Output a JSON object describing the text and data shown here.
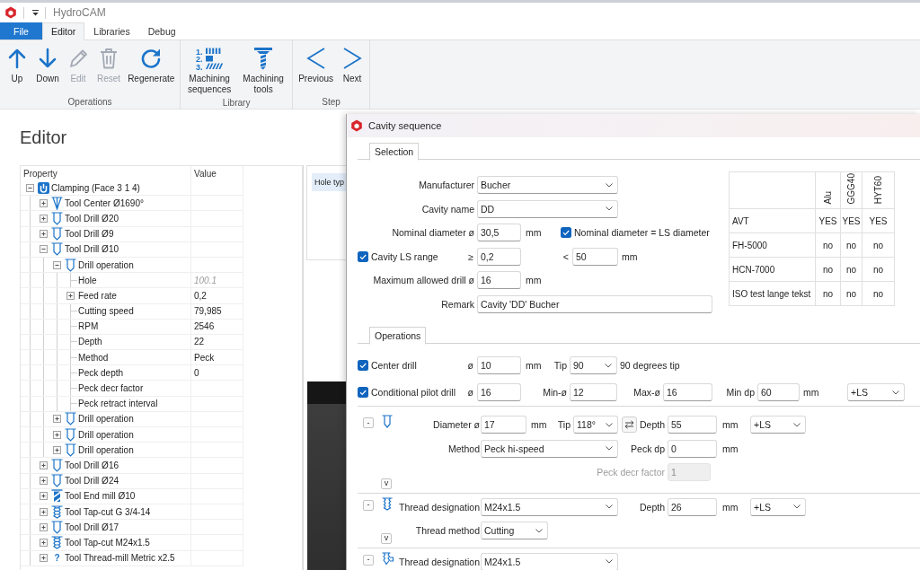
{
  "window": {
    "title": "HydroCAM"
  },
  "ribbon": {
    "tabs": [
      {
        "label": "File",
        "kind": "file",
        "selected": false
      },
      {
        "label": "Editor",
        "kind": "tab",
        "selected": true
      },
      {
        "label": "Libraries",
        "kind": "tab",
        "selected": false
      },
      {
        "label": "Debug",
        "kind": "tab",
        "selected": false
      }
    ],
    "groups": [
      {
        "label": "Operations",
        "buttons": [
          {
            "label": "Up",
            "kind": "up",
            "disabled": false
          },
          {
            "label": "Down",
            "kind": "down",
            "disabled": false
          },
          {
            "label": "Edit",
            "kind": "edit",
            "disabled": true
          },
          {
            "label": "Reset",
            "kind": "reset",
            "disabled": true
          },
          {
            "label": "Regenerate",
            "kind": "regenerate",
            "disabled": false
          }
        ]
      },
      {
        "label": "Library",
        "buttons": [
          {
            "label": "Machining sequences",
            "kind": "sequences",
            "disabled": false,
            "icon_numbers": [
              "1.",
              "2.",
              "3."
            ]
          },
          {
            "label": "Machining tools",
            "kind": "tools",
            "disabled": false
          }
        ]
      },
      {
        "label": "Step",
        "buttons": [
          {
            "label": "Previous",
            "kind": "previous",
            "disabled": false
          },
          {
            "label": "Next",
            "kind": "next",
            "disabled": false
          }
        ]
      }
    ]
  },
  "editor": {
    "title": "Editor",
    "property_grid": {
      "columns": [
        "Property",
        "Value"
      ],
      "rows": [
        {
          "label": "Clamping (Face 3 1 4)",
          "kind": "clamping",
          "expanded": true,
          "children": [
            {
              "label": "Tool Center Ø1690°",
              "kind": "center-drill",
              "expanded": false
            },
            {
              "label": "Tool Drill Ø20",
              "kind": "drill",
              "expanded": false
            },
            {
              "label": "Tool Drill Ø9",
              "kind": "drill",
              "expanded": false
            },
            {
              "label": "Tool Drill Ø10",
              "kind": "drill",
              "expanded": true,
              "children": [
                {
                  "label": "Drill operation",
                  "kind": "operation",
                  "expanded": true,
                  "children": [
                    {
                      "label": "Hole",
                      "value": "100.1",
                      "readonly": true
                    },
                    {
                      "label": "Feed rate",
                      "value": "0,2",
                      "readonly": false,
                      "expanded": false
                    },
                    {
                      "label": "Cutting speed",
                      "value": "79,985",
                      "readonly": false
                    },
                    {
                      "label": "RPM",
                      "value": "2546",
                      "readonly": false
                    },
                    {
                      "label": "Depth",
                      "value": "22",
                      "readonly": false
                    },
                    {
                      "label": "Method",
                      "value": "Peck",
                      "readonly": false
                    },
                    {
                      "label": "Peck depth",
                      "value": "0",
                      "readonly": false
                    },
                    {
                      "label": "Peck decr factor"
                    },
                    {
                      "label": "Peck retract interval"
                    }
                  ]
                },
                {
                  "label": "Drill operation",
                  "kind": "operation",
                  "expanded": false
                },
                {
                  "label": "Drill operation",
                  "kind": "operation",
                  "expanded": false
                },
                {
                  "label": "Drill operation",
                  "kind": "operation",
                  "expanded": false
                }
              ]
            },
            {
              "label": "Tool Drill Ø16",
              "kind": "drill",
              "expanded": false
            },
            {
              "label": "Tool Drill Ø24",
              "kind": "drill",
              "expanded": false
            },
            {
              "label": "Tool End mill Ø10",
              "kind": "end-mill",
              "expanded": false
            },
            {
              "label": "Tool Tap-cut G 3/4-14",
              "kind": "tap",
              "expanded": false
            },
            {
              "label": "Tool Drill Ø17",
              "kind": "drill",
              "expanded": false
            },
            {
              "label": "Tool Tap-cut M24x1.5",
              "kind": "tap",
              "expanded": false
            },
            {
              "label": "Tool Thread-mill Metric x2.5",
              "kind": "unknown",
              "icon_glyph": "?",
              "expanded": false
            }
          ]
        }
      ]
    },
    "hole_panel": {
      "header": "Hole typ"
    }
  },
  "dialog": {
    "title": "Cavity sequence",
    "selection": {
      "tab": {
        "label": "Selection",
        "selected": true
      },
      "manufacturer": {
        "label": "Manufacturer",
        "value": "Bucher"
      },
      "cavity_name": {
        "label": "Cavity name",
        "value": "DD"
      },
      "nominal_diameter": {
        "label": "Nominal diameter ø",
        "value": "30,5",
        "unit": "mm"
      },
      "nominal_equals_ls": {
        "label": "Nominal diameter = LS diameter",
        "checked": true
      },
      "ls_range": {
        "label": "Cavity LS range",
        "checked": true,
        "min_sign": "≥",
        "min": "0,2",
        "max_sign": "<",
        "max": "50",
        "unit": "mm"
      },
      "max_drill": {
        "label": "Maximum allowed drill ø",
        "value": "16",
        "unit": "mm"
      },
      "remark": {
        "label": "Remark",
        "value": "Cavity 'DD' Bucher"
      },
      "material_table": {
        "columns": [
          "Alu",
          "GGG40",
          "HYT60"
        ],
        "rows": [
          {
            "machine": "AVT",
            "cells": [
              "YES",
              "YES",
              "YES"
            ]
          },
          {
            "machine": "FH-5000",
            "cells": [
              "no",
              "no",
              "no"
            ]
          },
          {
            "machine": "HCN-7000",
            "cells": [
              "no",
              "no",
              "no"
            ]
          },
          {
            "machine": "ISO test lange tekst",
            "cells": [
              "no",
              "no",
              "no"
            ]
          }
        ]
      }
    },
    "operations": {
      "tab": {
        "label": "Operations",
        "selected": true
      },
      "center_drill": {
        "label": "Center drill",
        "checked": true,
        "diameter_sign": "ø",
        "diameter": "10",
        "unit": "mm",
        "tip_label": "Tip",
        "tip": "90",
        "tip_note": "90 degrees tip"
      },
      "pilot_drill": {
        "label": "Conditional pilot drill",
        "checked": true,
        "diameter_sign": "ø",
        "diameter": "16",
        "min_label": "Min-ø",
        "min": "12",
        "max_label": "Max-ø",
        "max": "16",
        "min_depth_label": "Min dp",
        "min_depth": "60",
        "unit": "mm",
        "reference": "+LS"
      },
      "steps": [
        {
          "kind": "drill",
          "collapse_button": "-",
          "expand_button": "v",
          "diameter": {
            "label": "Diameter ø",
            "value": "17",
            "unit": "mm"
          },
          "tip": {
            "label": "Tip",
            "value": "118°"
          },
          "depth": {
            "label": "Depth",
            "value": "55",
            "unit": "mm",
            "reference": "+LS"
          },
          "method": {
            "label": "Method",
            "value": "Peck hi-speed"
          },
          "peck_depth": {
            "label": "Peck dp",
            "value": "0",
            "unit": "mm"
          },
          "peck_decr_factor": {
            "label": "Peck decr factor",
            "value": "1",
            "disabled": true
          }
        },
        {
          "kind": "tap",
          "collapse_button": "-",
          "expand_button": "v",
          "thread": {
            "label": "Thread designation",
            "value": "M24x1.5"
          },
          "depth": {
            "label": "Depth",
            "value": "26",
            "unit": "mm",
            "reference": "+LS"
          },
          "thread_method": {
            "label": "Thread method",
            "value": "Cutting"
          }
        },
        {
          "kind": "thread-mill",
          "collapse_button": "-",
          "thread": {
            "label": "Thread designation",
            "value": "M24x1.5"
          }
        }
      ]
    }
  }
}
